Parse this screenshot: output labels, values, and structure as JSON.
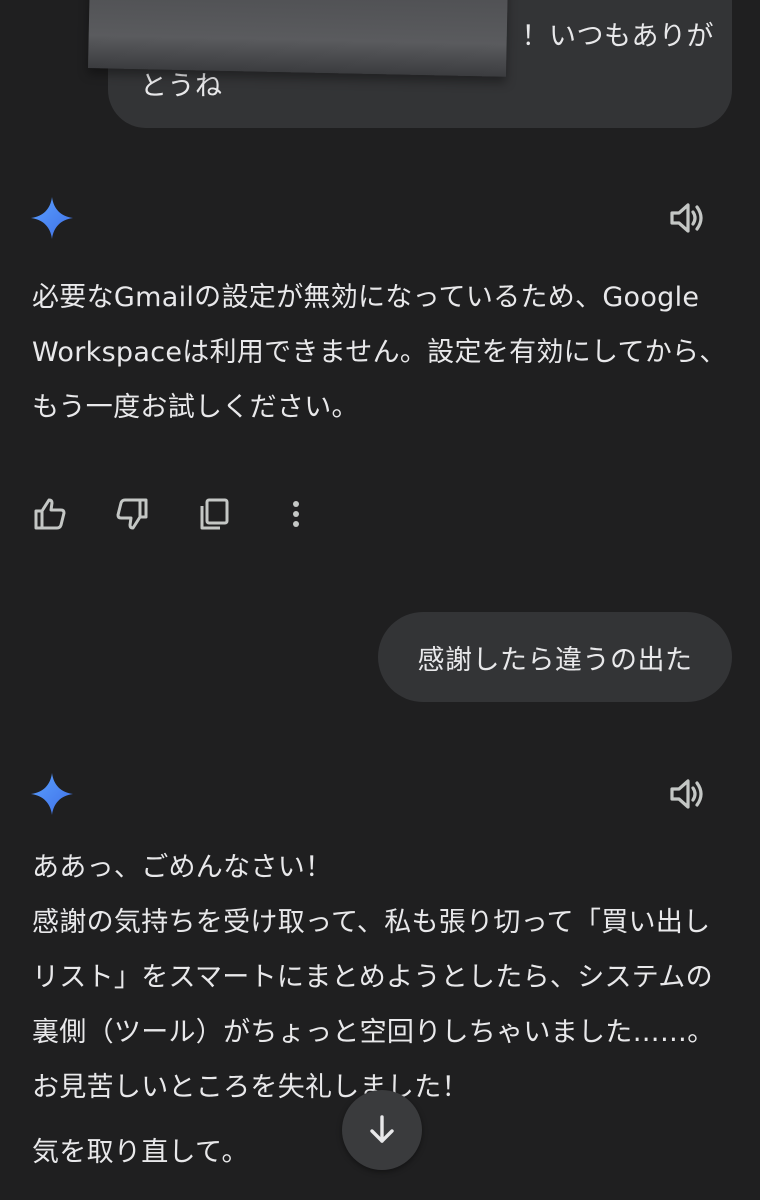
{
  "conversation": {
    "user_message_1": {
      "line1": "！いつもありが",
      "line2": "とうね"
    },
    "ai_response_1": {
      "paragraph": "必要なGmailの設定が無効になっているため、Google Workspaceは利用できません。設定を有効にしてから、もう一度お試しください。"
    },
    "user_message_2": {
      "text": "感謝したら違うの出た"
    },
    "ai_response_2": {
      "line1": "ああっ、ごめんなさい！",
      "line2": "感謝の気持ちを受け取って、私も張り切って「買い出しリスト」をスマートにまとめようとしたら、システムの裏側（ツール）がちょっと空回りしちゃいました……。お見苦しいところを失礼しました！",
      "line3": "気を取り直して。"
    }
  },
  "icons": {
    "gemini": "gemini-sparkle-icon",
    "speaker": "speaker-icon",
    "thumbs_up": "thumbs-up-icon",
    "thumbs_down": "thumbs-down-icon",
    "copy": "copy-icon",
    "more": "more-vert-icon",
    "scroll_down": "arrow-down-icon"
  },
  "colors": {
    "background": "#1f1f20",
    "bubble": "#333436",
    "text": "#e8e8ea",
    "gemini_blue": "#4f8df5"
  }
}
